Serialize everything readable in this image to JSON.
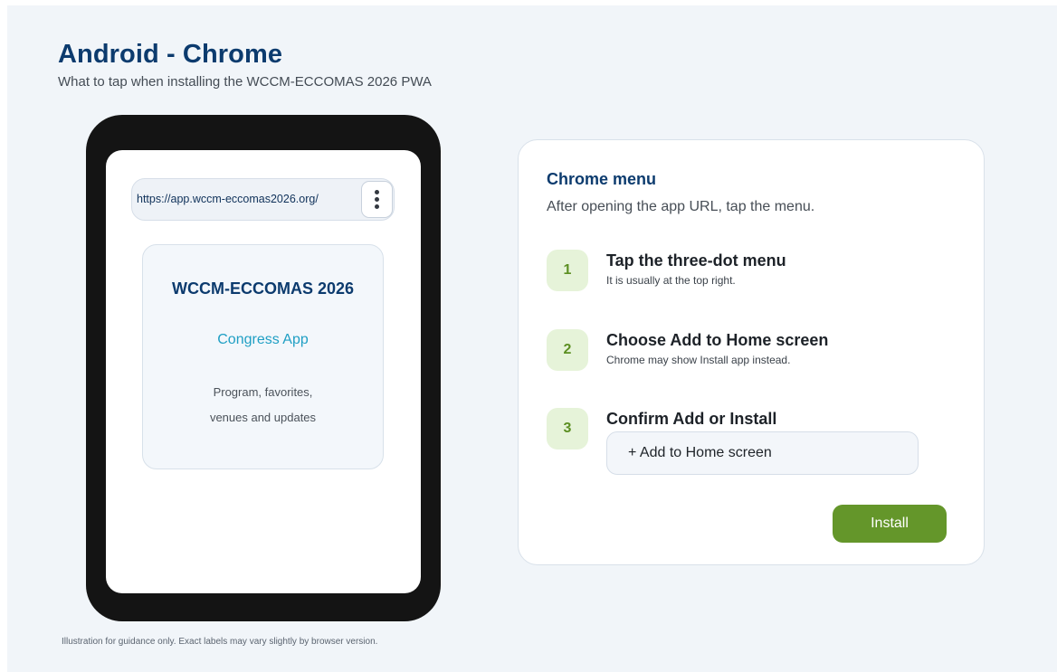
{
  "header": {
    "title": "Android - Chrome",
    "subtitle": "What to tap when installing the WCCM-ECCOMAS 2026 PWA"
  },
  "phone": {
    "url": "https://app.wccm-eccomas2026.org/",
    "menu_icon": "three-dot-vertical-icon",
    "app_card": {
      "title": "WCCM-ECCOMAS 2026",
      "subtitle": "Congress App",
      "description_line1": "Program, favorites,",
      "description_line2": "venues and updates"
    }
  },
  "footnote": "Illustration for guidance only. Exact labels may vary slightly by browser version.",
  "menu_card": {
    "title": "Chrome menu",
    "subtitle": "After opening the app URL, tap the menu.",
    "steps": [
      {
        "number": "1",
        "title": "Tap the three-dot menu",
        "description": "It is usually at the top right."
      },
      {
        "number": "2",
        "title": "Choose Add to Home screen",
        "description": "Chrome may show Install app instead."
      },
      {
        "number": "3",
        "title": "Confirm Add or Install",
        "description": ""
      }
    ],
    "add_home_label": "+ Add to Home screen",
    "install_label": "Install"
  },
  "colors": {
    "brand_navy": "#0c3b6e",
    "accent_green": "#64962a",
    "accent_cyan": "#1f9fc4",
    "background": "#f1f5f9"
  }
}
